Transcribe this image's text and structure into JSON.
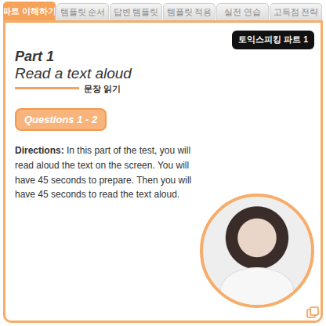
{
  "tabs": [
    {
      "label": "파트 이해하기",
      "selected": true
    },
    {
      "label": "템플릿 순서",
      "selected": false
    },
    {
      "label": "답변 템플릿",
      "selected": false
    },
    {
      "label": "템플릿 적용",
      "selected": false
    },
    {
      "label": "실전 연습",
      "selected": false
    },
    {
      "label": "고득점 전략",
      "selected": false
    }
  ],
  "badge": "토익스피킹 파트 1",
  "part": {
    "title": "Part 1",
    "subtitle": "Read a text aloud",
    "korean": "문장 읽기"
  },
  "questions": "Questions 1 - 2",
  "directions": {
    "label": "Directions:",
    "text": "In this part of the test, you will read aloud the text on the screen. You will have 45 seconds to prepare. Then you will have 45 seconds to read the text aloud."
  }
}
